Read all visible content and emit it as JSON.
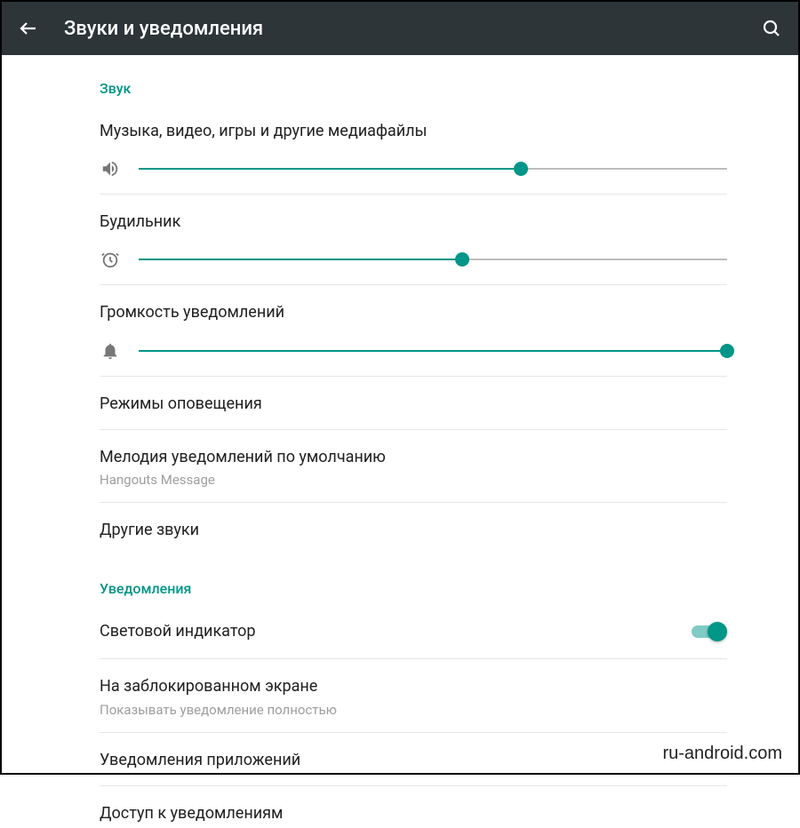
{
  "toolbar": {
    "title": "Звуки и уведомления"
  },
  "sections": {
    "sound": {
      "header": "Звук",
      "media": {
        "label": "Музыка, видео, игры и другие медиафайлы",
        "value": 65
      },
      "alarm": {
        "label": "Будильник",
        "value": 55
      },
      "notification_volume": {
        "label": "Громкость уведомлений",
        "value": 100
      },
      "interrupt": {
        "label": "Режимы оповещения"
      },
      "ringtone": {
        "label": "Мелодия уведомлений по умолчанию",
        "sub": "Hangouts Message"
      },
      "other": {
        "label": "Другие звуки"
      }
    },
    "notifications": {
      "header": "Уведомления",
      "led": {
        "label": "Световой индикатор",
        "on": true
      },
      "lockscreen": {
        "label": "На заблокированном экране",
        "sub": "Показывать уведомление полностью"
      },
      "apps": {
        "label": "Уведомления приложений"
      },
      "access": {
        "label": "Доступ к уведомлениям"
      }
    }
  },
  "watermark": "ru-android.com",
  "colors": {
    "accent": "#009688"
  }
}
